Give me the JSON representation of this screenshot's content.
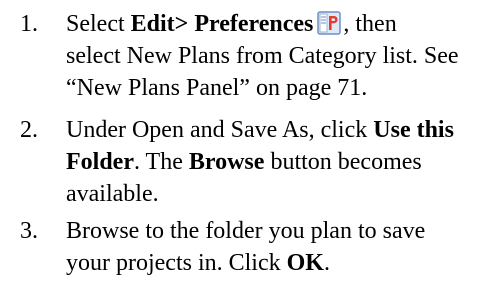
{
  "steps": [
    {
      "number": "1.",
      "lines": {
        "l1_pre": "Select ",
        "l1_bold": "Edit> Preferences",
        "l1_post": ", then",
        "l2": "select New Plans from Category list. See",
        "l3": "“New Plans Panel” on page 71."
      },
      "icon": "preferences-icon"
    },
    {
      "number": "2.",
      "lines": {
        "l1_pre": "Under Open and Save As, click ",
        "l1_bold": "Use this",
        "l2_bold": "Folder",
        "l2_mid": ". The ",
        "l2_bold2": "Browse",
        "l2_post": " button becomes",
        "l3": "available."
      }
    },
    {
      "number": "3.",
      "lines": {
        "l1": "Browse to the folder you plan to save",
        "l2_pre": "your projects in. Click ",
        "l2_bold": "OK",
        "l2_post": "."
      }
    }
  ],
  "colors": {
    "text": "#000000",
    "icon_border": "#6f8fc0",
    "icon_bg": "#dfe8f6",
    "icon_letter": "#e43d2f"
  }
}
